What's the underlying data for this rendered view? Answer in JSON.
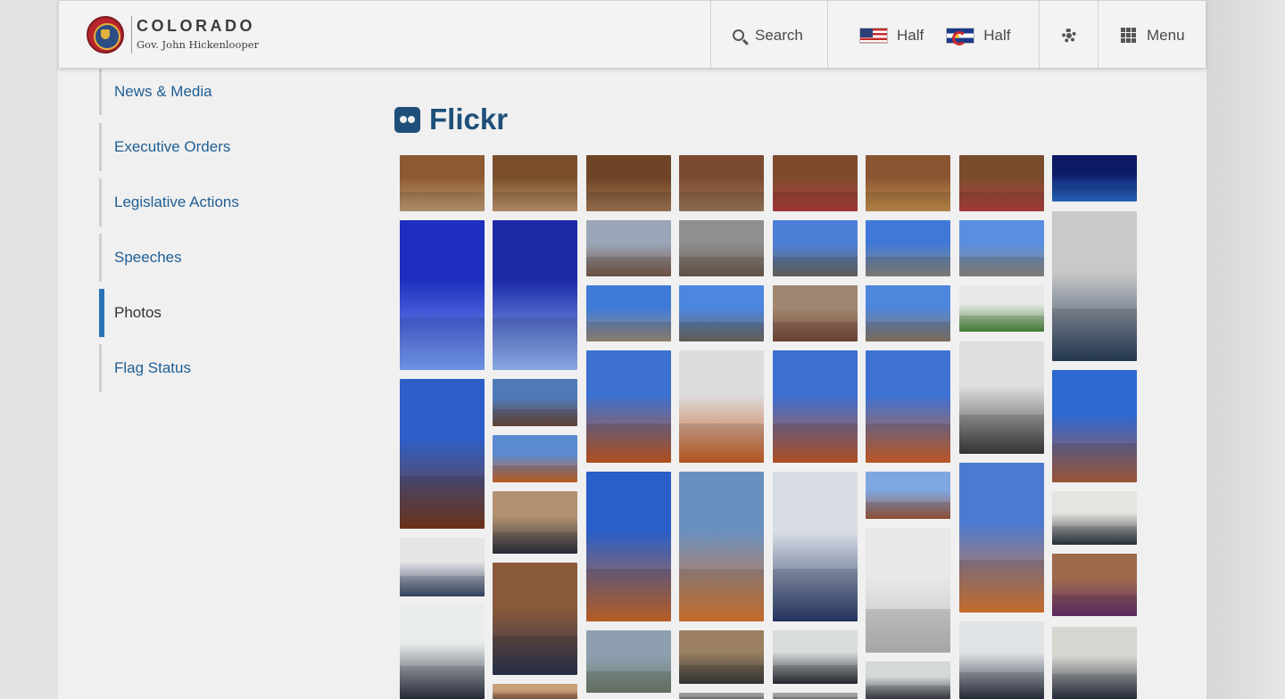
{
  "header": {
    "brand_title": "COLORADO",
    "brand_subtitle": "Gov. John Hickenlooper",
    "search_label": "Search",
    "flag_us_label": "Half",
    "flag_co_label": "Half",
    "menu_label": "Menu"
  },
  "sidebar": {
    "items": [
      {
        "label": "News & Media",
        "active": false
      },
      {
        "label": "Executive Orders",
        "active": false
      },
      {
        "label": "Legislative Actions",
        "active": false
      },
      {
        "label": "Speeches",
        "active": false
      },
      {
        "label": "Photos",
        "active": true
      },
      {
        "label": "Flag Status",
        "active": false
      }
    ]
  },
  "main": {
    "section_title": "Flickr"
  },
  "colors": {
    "link": "#1f5e94",
    "active_bar": "#2a73b5",
    "flickr_blue": "#1d4f7a"
  }
}
